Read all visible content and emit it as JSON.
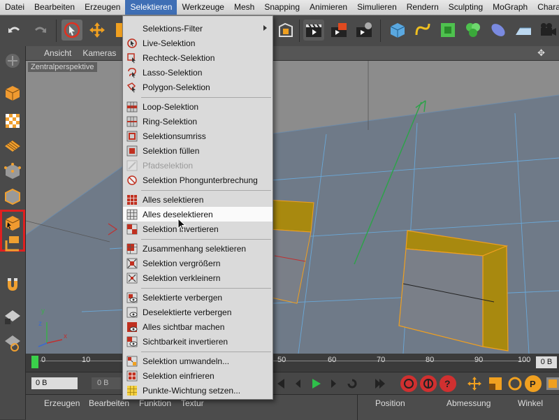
{
  "menubar": {
    "items": [
      "Datei",
      "Bearbeiten",
      "Erzeugen",
      "Selektieren",
      "Werkzeuge",
      "Mesh",
      "Snapping",
      "Animieren",
      "Simulieren",
      "Rendern",
      "Sculpting",
      "MoGraph",
      "Charakt"
    ],
    "active_index": 3
  },
  "viewport": {
    "menu": [
      "Ansicht",
      "Kameras"
    ],
    "label": "Zentralperspektive",
    "axis_y": "y",
    "axis_z": "z",
    "axis_x": "x"
  },
  "dropdown": {
    "items": [
      {
        "label": "Selektions-Filter",
        "icon": "blank",
        "submenu": true
      },
      {
        "label": "Live-Selektion",
        "icon": "live-selection-icon"
      },
      {
        "label": "Rechteck-Selektion",
        "icon": "rectangle-selection-icon"
      },
      {
        "label": "Lasso-Selektion",
        "icon": "lasso-selection-icon"
      },
      {
        "label": "Polygon-Selektion",
        "icon": "polygon-selection-icon"
      },
      {
        "label": "Loop-Selektion",
        "icon": "loop-selection-icon"
      },
      {
        "label": "Ring-Selektion",
        "icon": "ring-selection-icon"
      },
      {
        "label": "Selektionsumriss",
        "icon": "selection-outline-icon"
      },
      {
        "label": "Selektion füllen",
        "icon": "fill-selection-icon"
      },
      {
        "label": "Pfadselektion",
        "icon": "path-selection-icon",
        "disabled": true
      },
      {
        "label": "Selektion Phongunterbrechung",
        "icon": "phong-break-icon"
      },
      {
        "label": "Alles selektieren",
        "icon": "select-all-icon"
      },
      {
        "label": "Alles deselektieren",
        "icon": "deselect-all-icon",
        "highlighted": true
      },
      {
        "label": "Selektion invertieren",
        "icon": "invert-selection-icon"
      },
      {
        "label": "Zusammenhang selektieren",
        "icon": "select-connected-icon"
      },
      {
        "label": "Selektion vergrößern",
        "icon": "grow-selection-icon"
      },
      {
        "label": "Selektion verkleinern",
        "icon": "shrink-selection-icon"
      },
      {
        "label": "Selektierte verbergen",
        "icon": "hide-selected-icon"
      },
      {
        "label": "Deselektierte verbergen",
        "icon": "hide-unselected-icon"
      },
      {
        "label": "Alles sichtbar machen",
        "icon": "unhide-all-icon"
      },
      {
        "label": "Sichtbarkeit invertieren",
        "icon": "invert-visibility-icon"
      },
      {
        "label": "Selektion umwandeln...",
        "icon": "convert-selection-icon"
      },
      {
        "label": "Selektion einfrieren",
        "icon": "freeze-selection-icon"
      },
      {
        "label": "Punkte-Wichtung setzen...",
        "icon": "point-weight-icon"
      }
    ]
  },
  "timeline": {
    "ticks": [
      "0",
      "10",
      "50",
      "60",
      "70",
      "80",
      "90",
      "100"
    ],
    "current_frame_display": "0 B"
  },
  "transport": {
    "start_field": "0 B",
    "field2": "0 B"
  },
  "bottom_panel": {
    "menu": [
      "Erzeugen",
      "Bearbeiten",
      "Funktion",
      "Textur"
    ],
    "right_headers": [
      "Position",
      "Abmessung",
      "Winkel"
    ]
  },
  "colors": {
    "menu_highlight": "#3f6fb5",
    "selection_fill": "#a88a12",
    "selection_edge": "#f0a020",
    "highlight_frame": "#e02020"
  }
}
